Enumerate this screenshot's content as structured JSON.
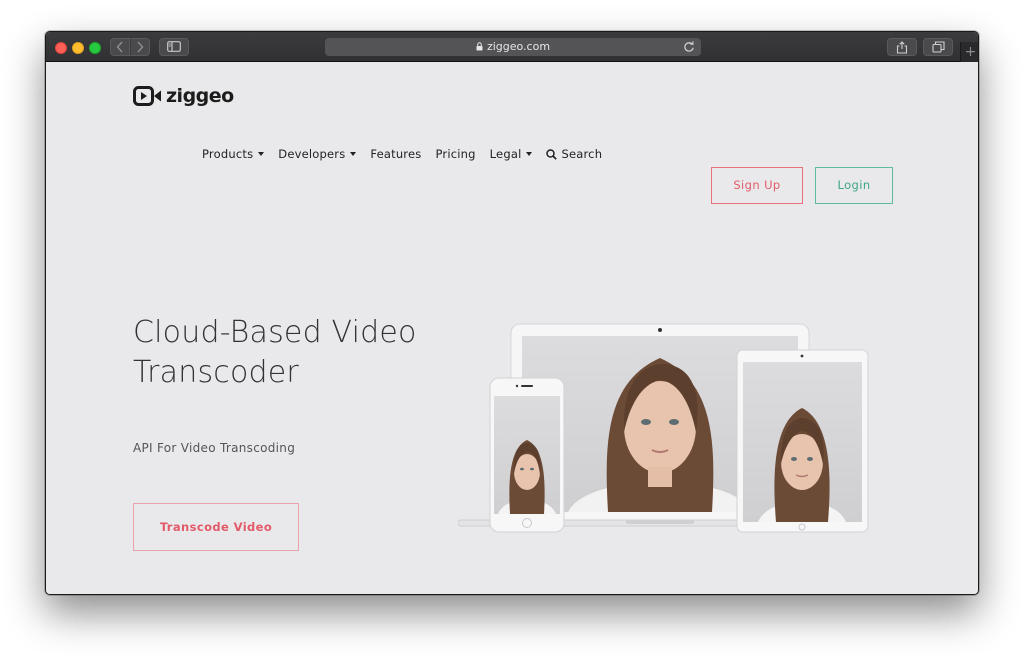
{
  "browser": {
    "url": "ziggeo.com",
    "new_tab_label": "+"
  },
  "logo": {
    "text": "ziggeo"
  },
  "nav": {
    "products": "Products",
    "developers": "Developers",
    "features": "Features",
    "pricing": "Pricing",
    "legal": "Legal",
    "search": "Search"
  },
  "auth": {
    "signup": "Sign Up",
    "login": "Login"
  },
  "hero": {
    "title": "Cloud-Based Video Transcoder",
    "subtitle": "API For Video Transcoding",
    "cta": "Transcode Video"
  },
  "colors": {
    "signup_accent": "#e35a69",
    "login_accent": "#3fa587",
    "page_background": "#e9e9eb"
  }
}
